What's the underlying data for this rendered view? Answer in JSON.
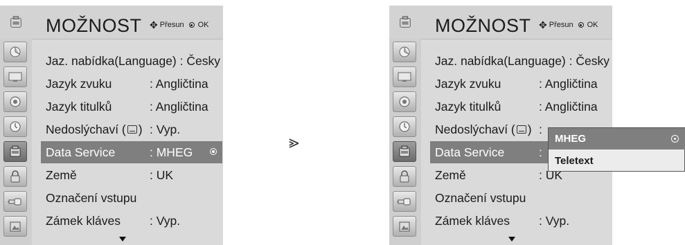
{
  "menu": {
    "title": "MOŽNOST",
    "hint_move": "Přesun",
    "hint_ok": "OK",
    "items": [
      {
        "label": "Jaz. nabídka(Language) : Česky",
        "value": ""
      },
      {
        "label": "Jazyk zvuku",
        "value": ": Angličtina"
      },
      {
        "label": "Jazyk titulků",
        "value": ": Angličtina"
      },
      {
        "label_pre": "Nedoslýchaví (",
        "label_post": ")",
        "value": ": Vyp."
      },
      {
        "label": "Data Service",
        "value": ": MHEG"
      },
      {
        "label": "Země",
        "value": ": UK"
      },
      {
        "label": "Označení vstupu",
        "value": ""
      },
      {
        "label": "Zámek kláves",
        "value": ": Vyp."
      }
    ]
  },
  "right_menu": {
    "title": "MOŽNOST",
    "hint_move": "Přesun",
    "hint_ok": "OK",
    "items": [
      {
        "label": "Jaz. nabídka(Language) : Česky",
        "value": ""
      },
      {
        "label": "Jazyk zvuku",
        "value": ": Angličtina"
      },
      {
        "label": "Jazyk titulků",
        "value": ": Angličtina"
      },
      {
        "label_pre": "Nedoslýchaví (",
        "label_post": ")",
        "value": ":"
      },
      {
        "label": "Data Service",
        "value": ":"
      },
      {
        "label": "Země",
        "value": ": UK"
      },
      {
        "label": "Označení vstupu",
        "value": ""
      },
      {
        "label": "Zámek kláves",
        "value": ": Vyp."
      }
    ]
  },
  "popup": {
    "options": [
      "MHEG",
      "Teletext"
    ],
    "selected": "MHEG"
  },
  "transition_symbol": "⪢",
  "category_icons": [
    "picture-setup-icon",
    "screen-icon",
    "audio-icon",
    "time-icon",
    "option-icon",
    "lock-icon",
    "input-icon",
    "usb-photo-icon"
  ]
}
